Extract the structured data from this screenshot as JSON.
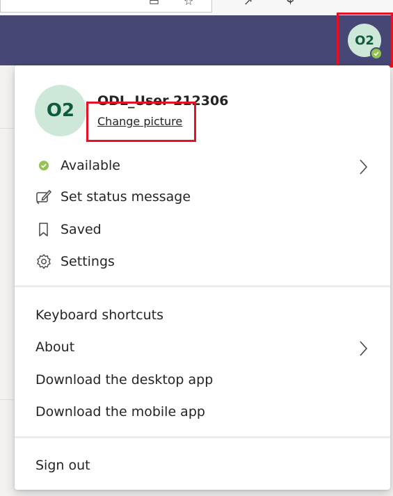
{
  "user": {
    "initials": "O2",
    "name": "ODL_User 212306",
    "change_picture": "Change picture"
  },
  "status_menu": [
    {
      "label": "Available",
      "icon": "available-status-icon"
    },
    {
      "label": "Set status message",
      "icon": "edit-status-icon"
    },
    {
      "label": "Saved",
      "icon": "bookmark-icon"
    },
    {
      "label": "Settings",
      "icon": "gear-icon"
    }
  ],
  "app_menu": [
    {
      "label": "Keyboard shortcuts"
    },
    {
      "label": "About"
    },
    {
      "label": "Download the desktop app"
    },
    {
      "label": "Download the mobile app"
    }
  ],
  "sign_out": "Sign out",
  "colors": {
    "header": "#464775",
    "presence_available": "#92c353",
    "avatar_bg": "#cde7d8",
    "highlight": "#e81123"
  }
}
